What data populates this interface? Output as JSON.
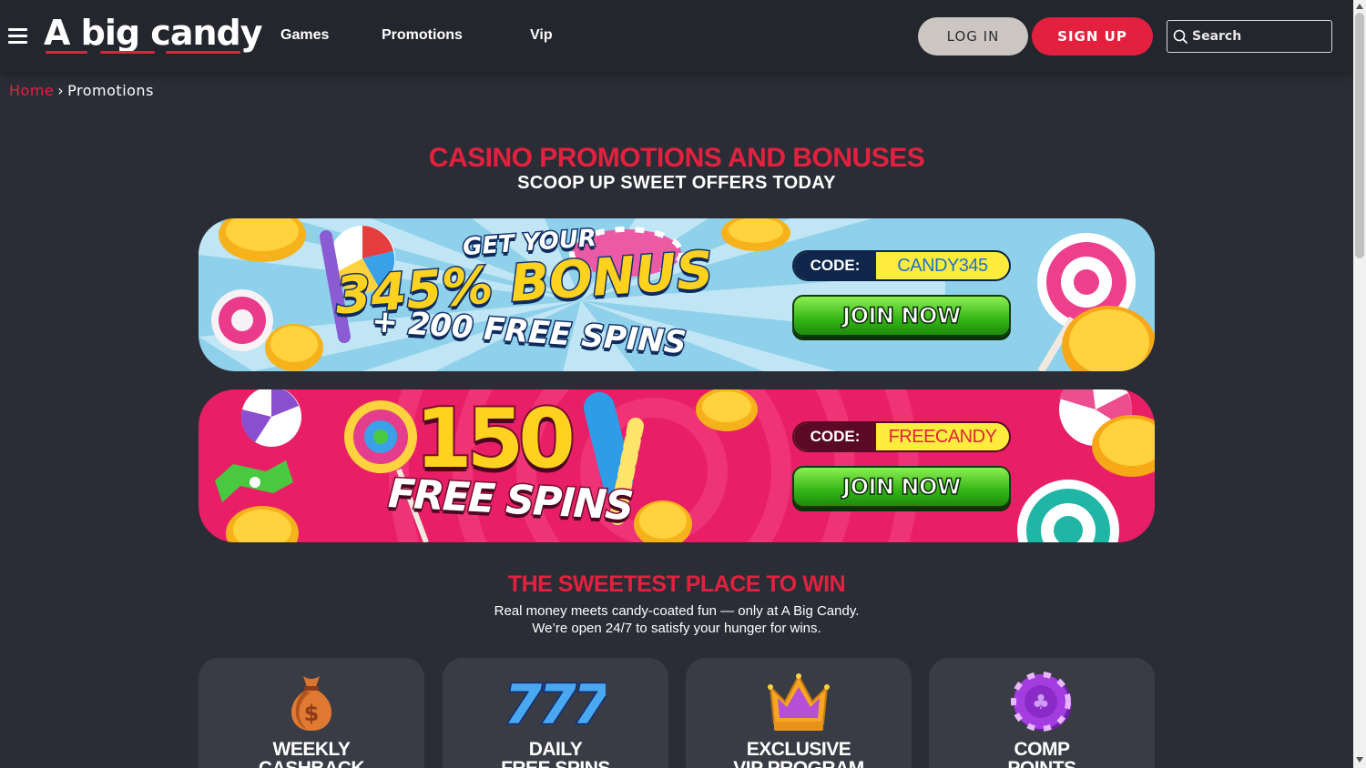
{
  "header": {
    "logo_text": "A big candy",
    "nav": [
      "Games",
      "Promotions",
      "Vip"
    ],
    "login_label": "LOG IN",
    "signup_label": "SIGN UP",
    "search_placeholder": "Search"
  },
  "breadcrumb": {
    "home": "Home",
    "separator": "›",
    "current": "Promotions"
  },
  "hero": {
    "title": "CASINO PROMOTIONS AND BONUSES",
    "subtitle": "SCOOP UP SWEET OFFERS TODAY"
  },
  "promos": [
    {
      "line1": "GET YOUR",
      "line2": "345% BONUS",
      "line3": "+ 200 FREE SPINS",
      "code_label": "CODE:",
      "code": "CANDY345",
      "join_label": "JOIN NOW",
      "code_color": "#1e74c9"
    },
    {
      "line1": "150",
      "line2": "FREE SPINS",
      "code_label": "CODE:",
      "code": "FREECANDY",
      "join_label": "JOIN NOW",
      "code_color": "#e3213f"
    }
  ],
  "win_section": {
    "title": "THE SWEETEST PLACE TO WIN",
    "line1": "Real money meets candy-coated fun — only at A Big Candy.",
    "line2": "We’re open 24/7 to satisfy your hunger for wins."
  },
  "cards": [
    {
      "icon": "money-bag-icon",
      "line1": "WEEKLY",
      "line2": "CASHBACK"
    },
    {
      "icon": "slot-777-icon",
      "line1": "DAILY",
      "line2": "FREE SPINS"
    },
    {
      "icon": "crown-icon",
      "line1": "EXCLUSIVE",
      "line2": "VIP PROGRAM"
    },
    {
      "icon": "poker-chips-icon",
      "line1": "COMP",
      "line2": "POINTS"
    }
  ],
  "colors": {
    "brand_red": "#e3213f",
    "background": "#2a2d35",
    "header_bg": "#24262d",
    "card_bg": "#393c45"
  }
}
